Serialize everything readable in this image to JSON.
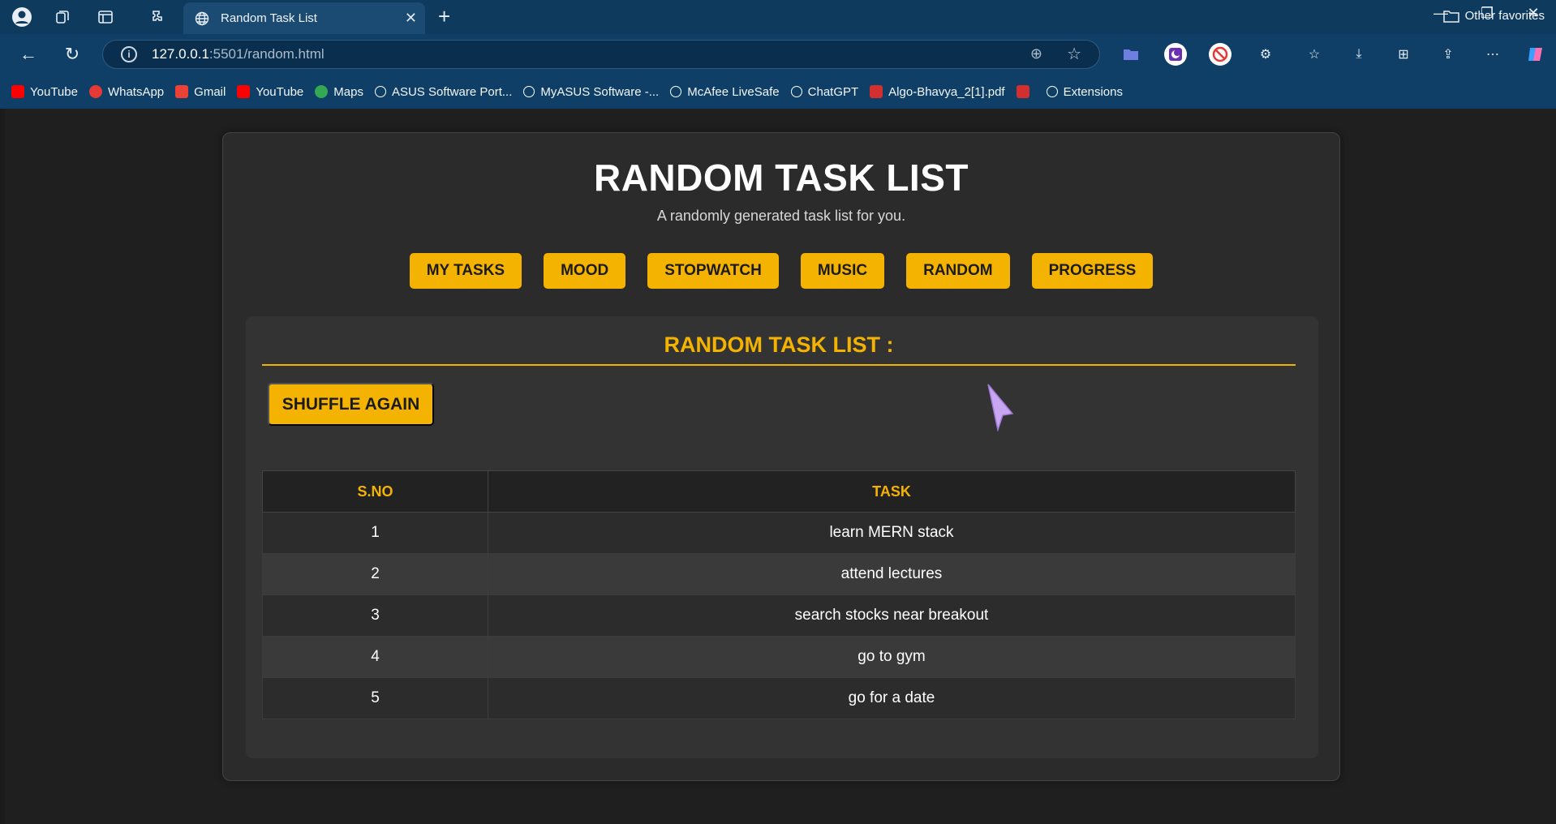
{
  "browser": {
    "tab_title": "Random Task List",
    "url_host": "127.0.0.1",
    "url_path": ":5501/random.html",
    "bookmarks": [
      {
        "label": "YouTube",
        "icon": "youtube-icon",
        "color": "#ff0000"
      },
      {
        "label": "WhatsApp",
        "icon": "whatsapp-icon",
        "color": "#e53935"
      },
      {
        "label": "Gmail",
        "icon": "gmail-icon",
        "color": "#ea4335"
      },
      {
        "label": "YouTube",
        "icon": "youtube-icon",
        "color": "#ff0000"
      },
      {
        "label": "Maps",
        "icon": "maps-icon",
        "color": "#34a853"
      },
      {
        "label": "ASUS Software Port...",
        "icon": "globe-icon",
        "color": "#ffffff"
      },
      {
        "label": "MyASUS Software -...",
        "icon": "globe-icon",
        "color": "#ffffff"
      },
      {
        "label": "McAfee LiveSafe",
        "icon": "globe-icon",
        "color": "#ffffff"
      },
      {
        "label": "ChatGPT",
        "icon": "chatgpt-icon",
        "color": "#ffffff"
      },
      {
        "label": "Algo-Bhavya_2[1].pdf",
        "icon": "pdf-icon",
        "color": "#d32f2f"
      },
      {
        "label": "",
        "icon": "pdf-icon",
        "color": "#d32f2f"
      },
      {
        "label": "Extensions",
        "icon": "extensions-icon",
        "color": "#ffffff"
      }
    ],
    "other_favorites": "Other favorites"
  },
  "app": {
    "title": "RANDOM TASK LIST",
    "subtitle": "A randomly generated task list for you.",
    "nav": [
      "MY TASKS",
      "MOOD",
      "STOPWATCH",
      "MUSIC",
      "RANDOM",
      "PROGRESS"
    ],
    "section_title": "RANDOM TASK LIST :",
    "shuffle_label": "SHUFFLE AGAIN",
    "table": {
      "headers": [
        "S.NO",
        "TASK"
      ],
      "rows": [
        [
          "1",
          "learn MERN stack"
        ],
        [
          "2",
          "attend lectures"
        ],
        [
          "3",
          "search stocks near breakout"
        ],
        [
          "4",
          "go to gym"
        ],
        [
          "5",
          "go for a date"
        ]
      ]
    },
    "accent_color": "#f5b301"
  }
}
